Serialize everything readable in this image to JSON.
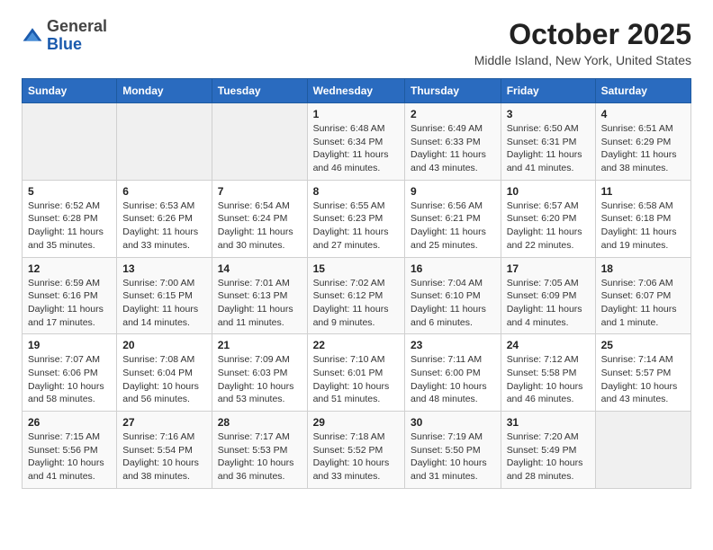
{
  "header": {
    "logo_general": "General",
    "logo_blue": "Blue",
    "month_title": "October 2025",
    "location": "Middle Island, New York, United States"
  },
  "weekdays": [
    "Sunday",
    "Monday",
    "Tuesday",
    "Wednesday",
    "Thursday",
    "Friday",
    "Saturday"
  ],
  "weeks": [
    [
      {
        "day": "",
        "info": ""
      },
      {
        "day": "",
        "info": ""
      },
      {
        "day": "",
        "info": ""
      },
      {
        "day": "1",
        "info": "Sunrise: 6:48 AM\nSunset: 6:34 PM\nDaylight: 11 hours and 46 minutes."
      },
      {
        "day": "2",
        "info": "Sunrise: 6:49 AM\nSunset: 6:33 PM\nDaylight: 11 hours and 43 minutes."
      },
      {
        "day": "3",
        "info": "Sunrise: 6:50 AM\nSunset: 6:31 PM\nDaylight: 11 hours and 41 minutes."
      },
      {
        "day": "4",
        "info": "Sunrise: 6:51 AM\nSunset: 6:29 PM\nDaylight: 11 hours and 38 minutes."
      }
    ],
    [
      {
        "day": "5",
        "info": "Sunrise: 6:52 AM\nSunset: 6:28 PM\nDaylight: 11 hours and 35 minutes."
      },
      {
        "day": "6",
        "info": "Sunrise: 6:53 AM\nSunset: 6:26 PM\nDaylight: 11 hours and 33 minutes."
      },
      {
        "day": "7",
        "info": "Sunrise: 6:54 AM\nSunset: 6:24 PM\nDaylight: 11 hours and 30 minutes."
      },
      {
        "day": "8",
        "info": "Sunrise: 6:55 AM\nSunset: 6:23 PM\nDaylight: 11 hours and 27 minutes."
      },
      {
        "day": "9",
        "info": "Sunrise: 6:56 AM\nSunset: 6:21 PM\nDaylight: 11 hours and 25 minutes."
      },
      {
        "day": "10",
        "info": "Sunrise: 6:57 AM\nSunset: 6:20 PM\nDaylight: 11 hours and 22 minutes."
      },
      {
        "day": "11",
        "info": "Sunrise: 6:58 AM\nSunset: 6:18 PM\nDaylight: 11 hours and 19 minutes."
      }
    ],
    [
      {
        "day": "12",
        "info": "Sunrise: 6:59 AM\nSunset: 6:16 PM\nDaylight: 11 hours and 17 minutes."
      },
      {
        "day": "13",
        "info": "Sunrise: 7:00 AM\nSunset: 6:15 PM\nDaylight: 11 hours and 14 minutes."
      },
      {
        "day": "14",
        "info": "Sunrise: 7:01 AM\nSunset: 6:13 PM\nDaylight: 11 hours and 11 minutes."
      },
      {
        "day": "15",
        "info": "Sunrise: 7:02 AM\nSunset: 6:12 PM\nDaylight: 11 hours and 9 minutes."
      },
      {
        "day": "16",
        "info": "Sunrise: 7:04 AM\nSunset: 6:10 PM\nDaylight: 11 hours and 6 minutes."
      },
      {
        "day": "17",
        "info": "Sunrise: 7:05 AM\nSunset: 6:09 PM\nDaylight: 11 hours and 4 minutes."
      },
      {
        "day": "18",
        "info": "Sunrise: 7:06 AM\nSunset: 6:07 PM\nDaylight: 11 hours and 1 minute."
      }
    ],
    [
      {
        "day": "19",
        "info": "Sunrise: 7:07 AM\nSunset: 6:06 PM\nDaylight: 10 hours and 58 minutes."
      },
      {
        "day": "20",
        "info": "Sunrise: 7:08 AM\nSunset: 6:04 PM\nDaylight: 10 hours and 56 minutes."
      },
      {
        "day": "21",
        "info": "Sunrise: 7:09 AM\nSunset: 6:03 PM\nDaylight: 10 hours and 53 minutes."
      },
      {
        "day": "22",
        "info": "Sunrise: 7:10 AM\nSunset: 6:01 PM\nDaylight: 10 hours and 51 minutes."
      },
      {
        "day": "23",
        "info": "Sunrise: 7:11 AM\nSunset: 6:00 PM\nDaylight: 10 hours and 48 minutes."
      },
      {
        "day": "24",
        "info": "Sunrise: 7:12 AM\nSunset: 5:58 PM\nDaylight: 10 hours and 46 minutes."
      },
      {
        "day": "25",
        "info": "Sunrise: 7:14 AM\nSunset: 5:57 PM\nDaylight: 10 hours and 43 minutes."
      }
    ],
    [
      {
        "day": "26",
        "info": "Sunrise: 7:15 AM\nSunset: 5:56 PM\nDaylight: 10 hours and 41 minutes."
      },
      {
        "day": "27",
        "info": "Sunrise: 7:16 AM\nSunset: 5:54 PM\nDaylight: 10 hours and 38 minutes."
      },
      {
        "day": "28",
        "info": "Sunrise: 7:17 AM\nSunset: 5:53 PM\nDaylight: 10 hours and 36 minutes."
      },
      {
        "day": "29",
        "info": "Sunrise: 7:18 AM\nSunset: 5:52 PM\nDaylight: 10 hours and 33 minutes."
      },
      {
        "day": "30",
        "info": "Sunrise: 7:19 AM\nSunset: 5:50 PM\nDaylight: 10 hours and 31 minutes."
      },
      {
        "day": "31",
        "info": "Sunrise: 7:20 AM\nSunset: 5:49 PM\nDaylight: 10 hours and 28 minutes."
      },
      {
        "day": "",
        "info": ""
      }
    ]
  ]
}
